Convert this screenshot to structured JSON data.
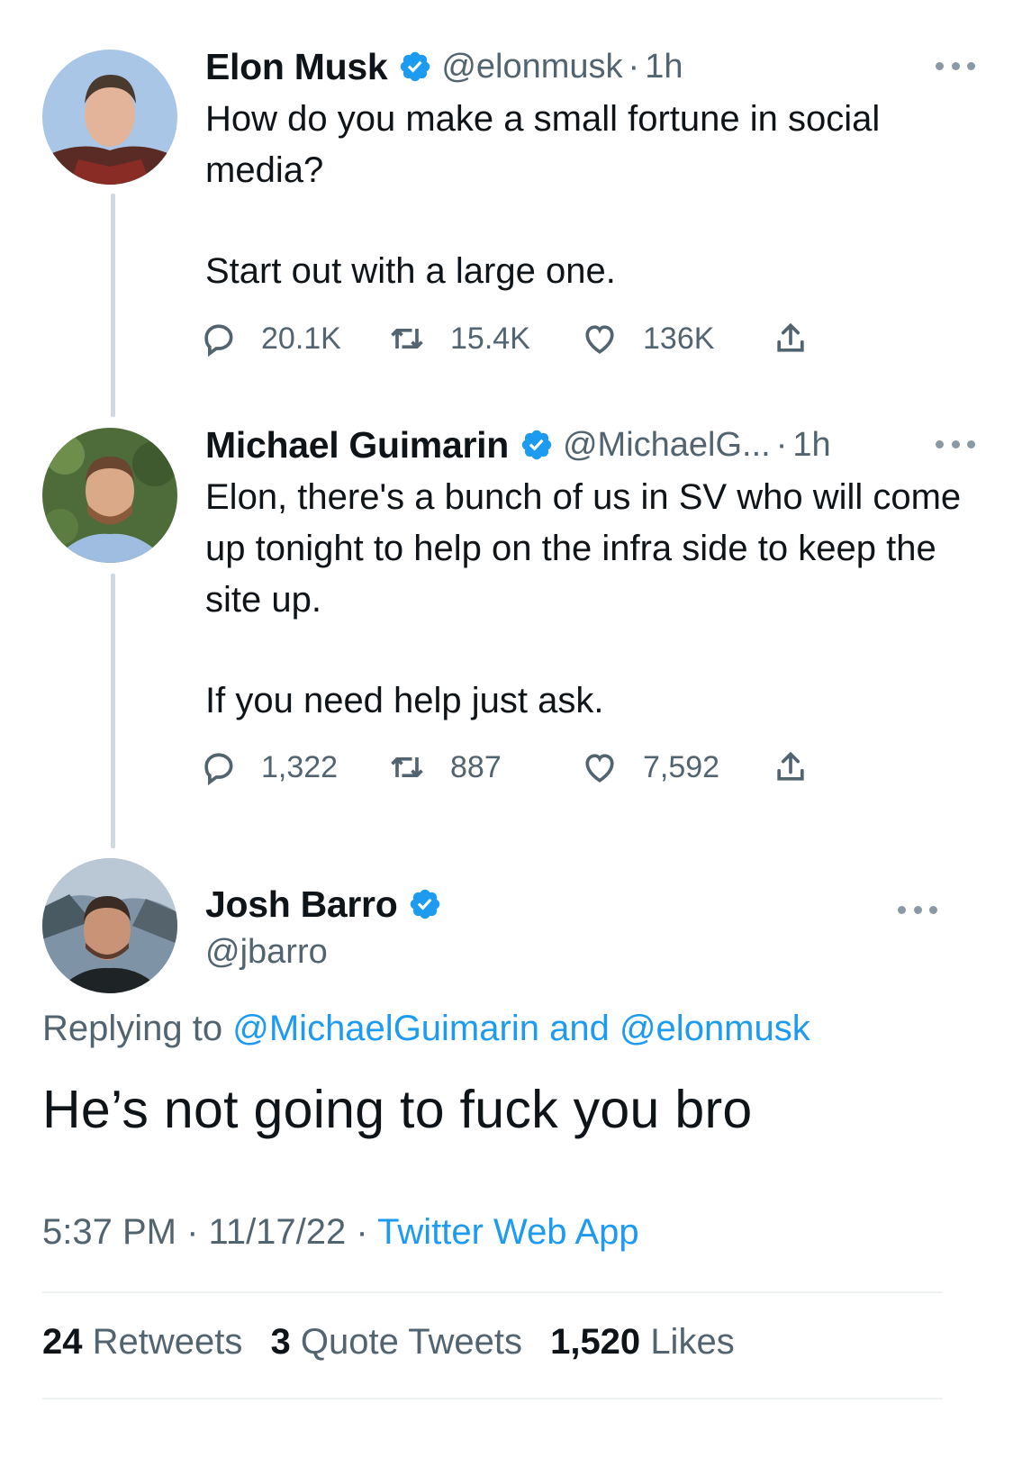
{
  "thread": [
    {
      "name": "Elon Musk",
      "handle": "@elonmusk",
      "separator": "·",
      "time": "1h",
      "paragraphs": [
        "How do you make a small fortune in social media?",
        "Start out with a large one."
      ],
      "replies": "20.1K",
      "retweets": "15.4K",
      "likes": "136K"
    },
    {
      "name": "Michael Guimarin",
      "handle": "@MichaelG...",
      "separator": "·",
      "time": "1h",
      "paragraphs": [
        "Elon, there's a bunch of us in SV who will come up tonight to help on the infra side to keep the site up.",
        "If you need help just ask."
      ],
      "replies": "1,322",
      "retweets": "887",
      "likes": "7,592"
    }
  ],
  "main_tweet": {
    "name": "Josh Barro",
    "handle": "@jbarro",
    "replying_prefix": "Replying to",
    "replying_user1": "@MichaelGuimarin",
    "replying_and": "and",
    "replying_user2": "@elonmusk",
    "text": "He’s not going to fuck you bro",
    "time": "5:37 PM",
    "date": "11/17/22",
    "separator": "·",
    "source": "Twitter Web App",
    "retweets_count": "24",
    "retweets_label": "Retweets",
    "quotes_count": "3",
    "quotes_label": "Quote Tweets",
    "likes_count": "1,520",
    "likes_label": "Likes"
  },
  "colors": {
    "accent": "#1d9bf0",
    "verified": "#1d9bf0",
    "secondary_text": "#536471",
    "thread_line": "#cfd9de"
  },
  "icons": [
    "verified-badge-icon",
    "more-icon",
    "reply-icon",
    "retweet-icon",
    "like-icon",
    "share-icon"
  ]
}
